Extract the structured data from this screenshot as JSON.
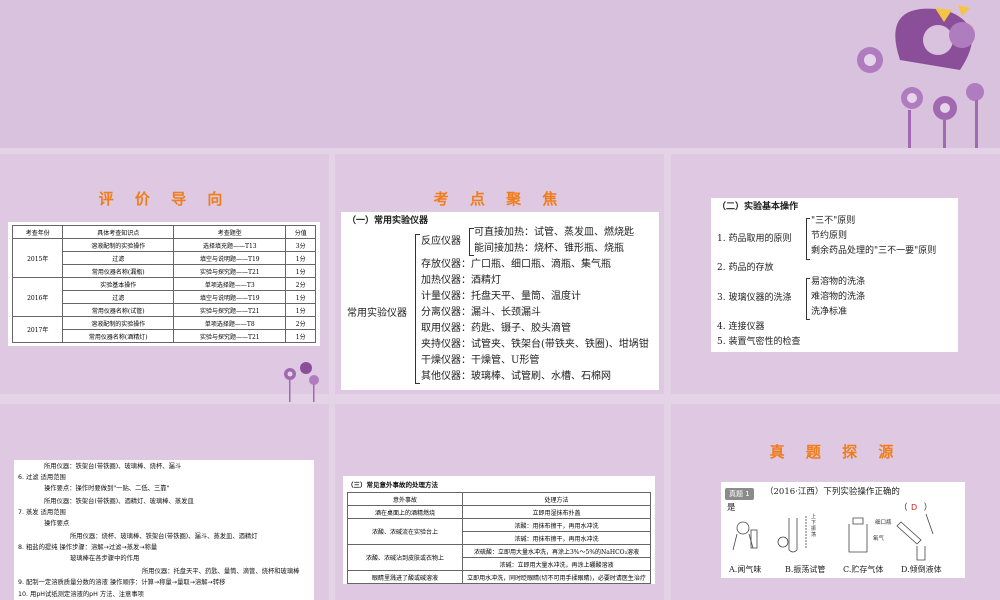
{
  "slide2": {
    "title": "评 价 导 向",
    "headers": [
      "考查年份",
      "具体考查知识点",
      "考查题型",
      "分值"
    ],
    "rows": [
      {
        "year": "2015年",
        "point": "溶液配制的实验操作",
        "type": "选择填充题——T13",
        "score": "3分"
      },
      {
        "year": "",
        "point": "过滤",
        "type": "填空与说明题——T19",
        "score": "1分"
      },
      {
        "year": "",
        "point": "常用仪器名称(漏瓶)",
        "type": "实验与探究题——T21",
        "score": "1分"
      },
      {
        "year": "2016年",
        "point": "实验基本操作",
        "type": "单项选择题——T3",
        "score": "2分"
      },
      {
        "year": "",
        "point": "过滤",
        "type": "填空与说明题——T19",
        "score": "1分"
      },
      {
        "year": "",
        "point": "常用仪器名称(试管)",
        "type": "实验与探究题——T21",
        "score": "1分"
      },
      {
        "year": "2017年",
        "point": "溶液配制的实验操作",
        "type": "单项选择题——T8",
        "score": "2分"
      },
      {
        "year": "",
        "point": "常用仪器名称(酒精灯)",
        "type": "实验与探究题——T21",
        "score": "1分"
      }
    ]
  },
  "slide3": {
    "title": "考 点 聚 焦",
    "heading": "（一）常用实验仪器",
    "root": "常用实验仪器",
    "react_label": "反应仪器",
    "react_items": [
      "可直接加热：试管、蒸发皿、燃烧匙",
      "能间接加热：烧杯、锥形瓶、烧瓶"
    ],
    "items": [
      "存放仪器：广口瓶、细口瓶、滴瓶、集气瓶",
      "加热仪器：酒精灯",
      "计量仪器：托盘天平、量筒、温度计",
      "分离仪器：漏斗、长颈漏斗",
      "取用仪器：药匙、镊子、胶头滴管",
      "夹持仪器：试管夹、铁架台(带铁夹、铁圈)、坩埚钳",
      "干燥仪器：干燥管、U形管",
      "其他仪器：玻璃棒、试管刷、水槽、石棉网"
    ]
  },
  "slide4": {
    "heading": "（二）实验基本操作",
    "item1": "1. 药品取用的原则",
    "item1_sub": [
      "\"三不\"原则",
      "节约原则",
      "剩余药品处理的\"三不一要\"原则"
    ],
    "item2": "2. 药品的存放",
    "item3": "3. 玻璃仪器的洗涤",
    "item3_sub": [
      "易溶物的洗涤",
      "难溶物的洗涤",
      "洗净标准"
    ],
    "item4": "4. 连接仪器",
    "item5": "5. 装置气密性的检查"
  },
  "slide5": {
    "lines": [
      "所用仪器：铁架台(带铁圈)、玻璃棒、烧杯、漏斗",
      "6. 过滤  适用范围",
      "操作要点：操作时要做到\"一贴、二低、三靠\"",
      "所用仪器：铁架台(带铁圈)、酒精灯、玻璃棒、蒸发皿",
      "7. 蒸发  适用范围",
      "操作要点",
      "所用仪器：烧杯、玻璃棒、铁架台(带铁圈)、漏斗、蒸发皿、酒精灯",
      "8. 粗盐的提纯  操作步骤：溶解→过滤→蒸发→称量",
      "玻璃棒在各步骤中的作用",
      "所用仪器：托盘天平、药匙、量筒、滴管、烧杯和玻璃棒",
      "9. 配制一定溶质质量分数的溶液  操作顺序：计算→称量→量取→溶解→转移",
      "10. 用pH试纸测定溶液的pH 方法、注意事项"
    ]
  },
  "slide6": {
    "heading": "（三）常见意外事故的处理方法",
    "headers": [
      "意外事故",
      "处理方法"
    ],
    "rows": [
      [
        "酒在桌面上的酒精燃烧",
        "立即用湿抹布扑盖"
      ],
      [
        "浓酸、浓碱流在实验台上",
        "浓酸：用抹布擦干，再用水冲洗"
      ],
      [
        "",
        "浓碱：用抹布擦干，再用水冲洗"
      ],
      [
        "浓酸、浓碱沾到皮肤或衣物上",
        "浓硫酸：立即用大量水冲洗，再涂上3%～5%的NaHCO₃溶液"
      ],
      [
        "",
        "浓碱：立即用大量水冲洗，再涂上硼酸溶液"
      ],
      [
        "眼睛里溅进了酸或碱溶液",
        "立即用水冲洗，同时眨眼睛(切不可用手揉眼睛)，必要时请医生治疗"
      ]
    ]
  },
  "slide7": {
    "title": "真 题 探 源",
    "badge": "真题 1",
    "question_line1": "（2016·江西）下列实验操作正确的",
    "question_line2": "是",
    "answer": "D",
    "labels": [
      "A.闻气味",
      "B.振荡试管",
      "C.贮存气体",
      "D.倾倒液体"
    ],
    "annot_shake": "上下振荡",
    "annot_jar": "细口瓶",
    "annot_gas": "氧气"
  }
}
